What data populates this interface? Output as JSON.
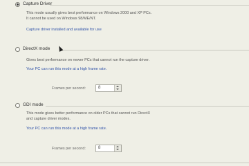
{
  "options": [
    {
      "label": "Capture Driver",
      "checked": true,
      "desc": [
        "This mode usually gives best performance on Windows 2000 and XP PCs.",
        "It cannot be used on Windows 98/ME/NT."
      ],
      "link": "Capture driver installed and available for use"
    },
    {
      "label": "DirectX mode",
      "checked": false,
      "desc": [
        "Gives best performance on newer PCs that cannot run the capture driver."
      ],
      "link": "Your PC can run this mode at a high frame rate.",
      "fps_label": "Frames per second:",
      "fps_value": "8"
    },
    {
      "label": "GDI mode",
      "checked": false,
      "desc": [
        "This mode gives better performance on older PCs that cannot run DirectX",
        "and capture driver modes."
      ],
      "link": "Your PC can run this mode at a high frame rate.",
      "fps_label": "Frames per second:",
      "fps_value": "8"
    }
  ]
}
